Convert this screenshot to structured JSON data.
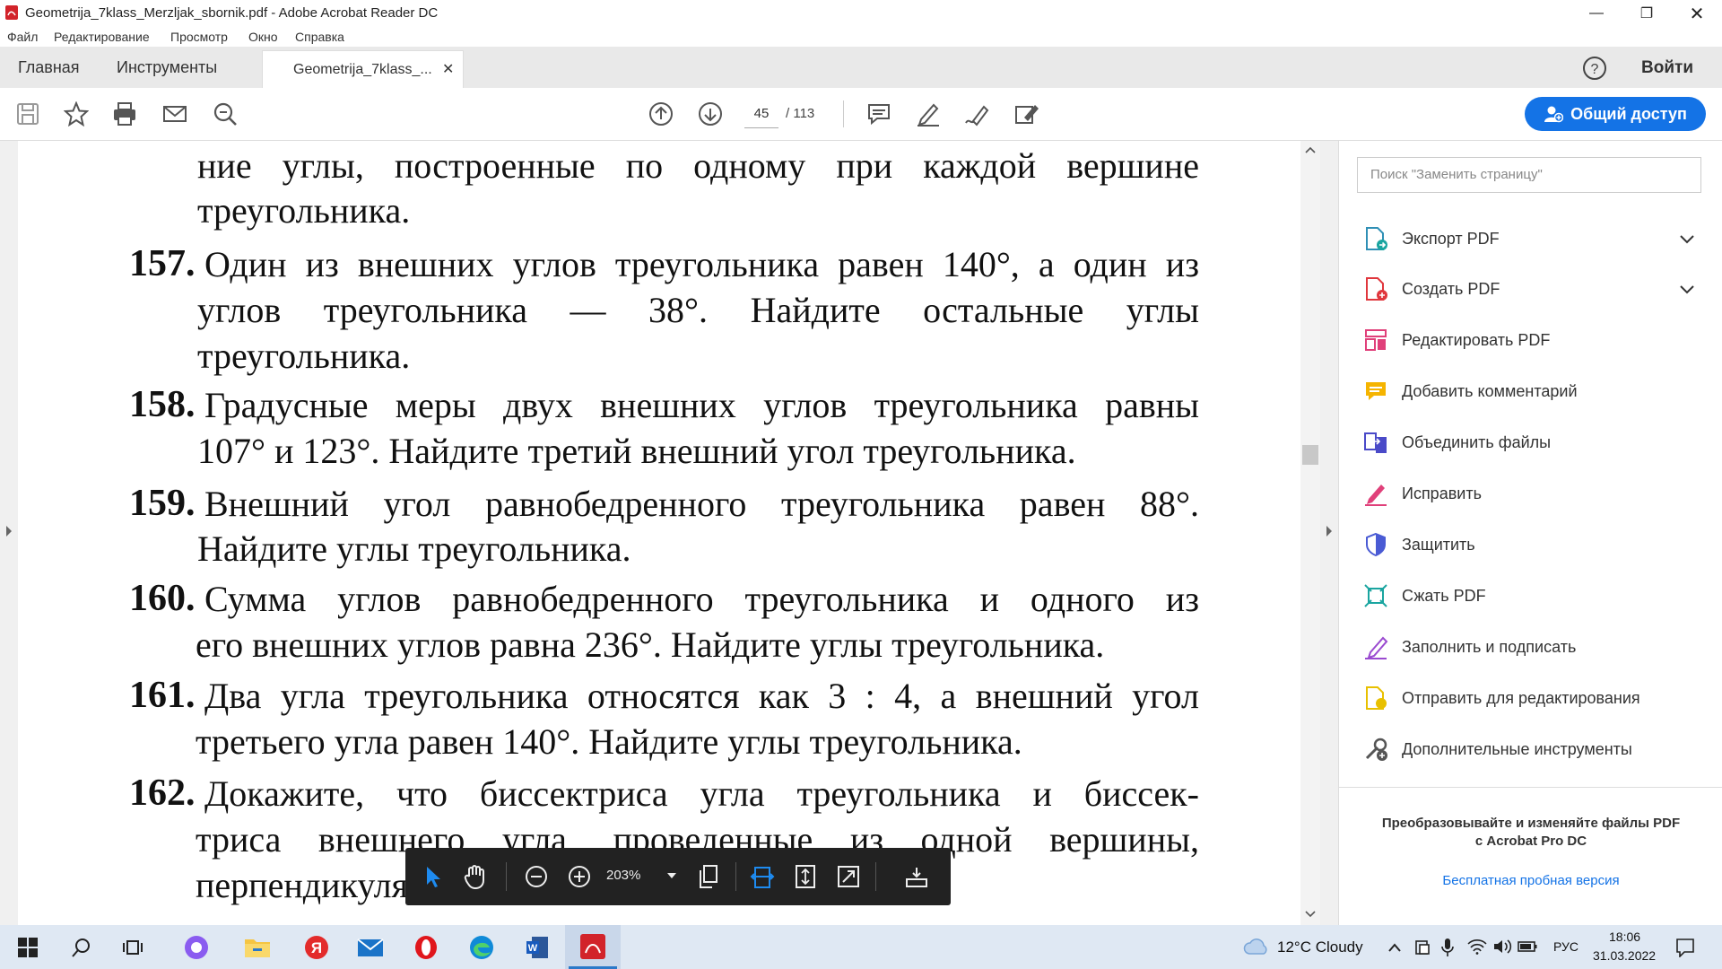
{
  "window": {
    "title": "Geometrija_7klass_Merzljak_sbornik.pdf - Adobe Acrobat Reader DC"
  },
  "menu": [
    "Файл",
    "Редактирование",
    "Просмотр",
    "Окно",
    "Справка"
  ],
  "tabs": {
    "home": "Главная",
    "tools": "Инструменты",
    "document": "Geometrija_7klass_..."
  },
  "header_right": {
    "signin": "Войти"
  },
  "toolbar": {
    "page_current": "45",
    "page_total": "/ 113",
    "share_label": "Общий доступ"
  },
  "document_lines": [
    {
      "num": "",
      "text": "ние углы, построенные по одному при каждой вершине"
    },
    {
      "num": "",
      "text": "треугольника."
    },
    {
      "num": "157.",
      "text": "Один из внешних углов треугольника равен 140°, а один из"
    },
    {
      "num": "",
      "text": "углов треугольника — 38°. Найдите остальные углы"
    },
    {
      "num": "",
      "text": "треугольника."
    },
    {
      "num": "158.",
      "text": "Градусные меры двух внешних углов треугольника равны"
    },
    {
      "num": "",
      "text": "107° и 123°. Найдите третий внешний угол треугольника."
    },
    {
      "num": "159.",
      "text": "Внешний угол равнобедренного треугольника равен 88°."
    },
    {
      "num": "",
      "text": "Найдите углы треугольника."
    },
    {
      "num": "160.",
      "text": "Сумма углов равнобедренного треугольника и одного из"
    },
    {
      "num": "",
      "text": "его внешних углов равна 236°. Найдите углы треугольника."
    },
    {
      "num": "161.",
      "text": "Два угла треугольника относятся как 3 : 4, а внешний угол"
    },
    {
      "num": "",
      "text": "третьего угла равен 140°. Найдите углы треугольника."
    },
    {
      "num": "162.",
      "text": "Докажите, что биссектриса угла треугольника и биссек-"
    },
    {
      "num": "",
      "text": "триса внешнего угла, проведенные из одной вершины,"
    },
    {
      "num": "",
      "text": "перпендикулярны."
    }
  ],
  "right_panel": {
    "search_placeholder": "Поиск \"Заменить страницу\"",
    "items": [
      {
        "label": "Экспорт PDF",
        "icon": "export-pdf-icon",
        "color": "#2f8fb5"
      },
      {
        "label": "Создать PDF",
        "icon": "create-pdf-icon",
        "color": "#e0373d"
      },
      {
        "label": "Редактировать PDF",
        "icon": "edit-pdf-icon",
        "color": "#e0407a"
      },
      {
        "label": "Добавить комментарий",
        "icon": "comment-icon",
        "color": "#f5b400"
      },
      {
        "label": "Объединить файлы",
        "icon": "combine-files-icon",
        "color": "#4a4ac8"
      },
      {
        "label": "Исправить",
        "icon": "redact-icon",
        "color": "#e0407a"
      },
      {
        "label": "Защитить",
        "icon": "protect-icon",
        "color": "#4a5bd4"
      },
      {
        "label": "Сжать PDF",
        "icon": "compress-pdf-icon",
        "color": "#1aa5a0"
      },
      {
        "label": "Заполнить и подписать",
        "icon": "fill-sign-icon",
        "color": "#9a4ad0"
      },
      {
        "label": "Отправить для редактирования",
        "icon": "send-review-icon",
        "color": "#e8c000"
      },
      {
        "label": "Дополнительные инструменты",
        "icon": "more-tools-icon",
        "color": "#555555"
      }
    ],
    "promo_line1": "Преобразовывайте и изменяйте файлы PDF",
    "promo_line2": "с Acrobat Pro DC",
    "trial_link": "Бесплатная пробная версия"
  },
  "floating_toolbar": {
    "zoom": "203%"
  },
  "taskbar": {
    "weather": "12°C  Cloudy",
    "lang": "РУС",
    "time": "18:06",
    "date": "31.03.2022"
  }
}
